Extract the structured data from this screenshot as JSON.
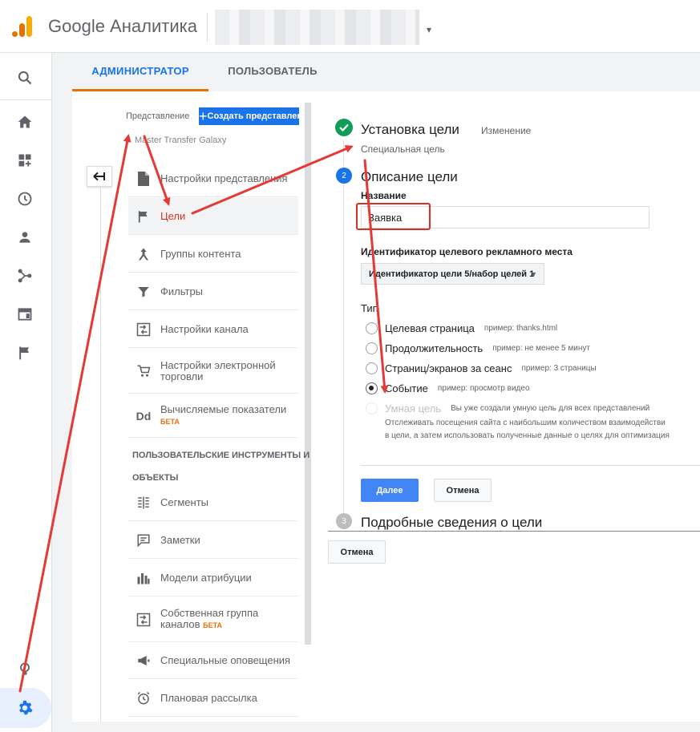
{
  "header": {
    "app_title": "Google Аналитика",
    "account_caret": "▾"
  },
  "tabs": [
    {
      "label": "АДМИНИСТРАТОР"
    },
    {
      "label": "ПОЛЬЗОВАТЕЛЬ"
    }
  ],
  "view": {
    "label": "Представление",
    "create_button": "Создать представление",
    "name": "Master Transfer Galaxy"
  },
  "menu": {
    "items": [
      {
        "label": "Настройки представления"
      },
      {
        "label": "Цели"
      },
      {
        "label": "Группы контента"
      },
      {
        "label": "Фильтры"
      },
      {
        "label": "Настройки канала"
      },
      {
        "label": "Настройки электронной торговли"
      },
      {
        "label": "Вычисляемые показатели",
        "badge": "БЕТА"
      }
    ],
    "section_tools": "ПОЛЬЗОВАТЕЛЬСКИЕ ИНСТРУМЕНТЫ И",
    "section_objects": "ОБЪЕКТЫ",
    "tools": [
      {
        "label": "Сегменты"
      },
      {
        "label": "Заметки"
      },
      {
        "label": "Модели атрибуции"
      },
      {
        "label": "Собственная группа каналов",
        "badge": "БЕТА"
      },
      {
        "label": "Специальные оповещения"
      },
      {
        "label": "Плановая рассылка"
      }
    ]
  },
  "goal": {
    "step1": {
      "title": "Установка цели",
      "edit": "Изменение",
      "subtitle": "Специальная цель"
    },
    "step2": {
      "number": "2",
      "title": "Описание цели"
    },
    "name_label": "Название",
    "name_value": "Заявка",
    "slot_label": "Идентификатор целевого рекламного места",
    "slot_value": "Идентификатор цели 5/набор целей 1",
    "type_label": "Тип",
    "types": [
      {
        "label": "Целевая страница",
        "example": "пример: thanks.html"
      },
      {
        "label": "Продолжительность",
        "example": "пример: не менее 5 минут"
      },
      {
        "label": "Страниц/экранов за сеанс",
        "example": "пример: 3 страницы"
      },
      {
        "label": "Событие",
        "example": "пример: просмотр видео"
      },
      {
        "label": "Умная цель",
        "example": "Вы уже создали умную цель для всех представлений"
      }
    ],
    "smart_desc_1": "Отслеживать посещения сайта с наибольшим количеством взаимодействи",
    "smart_desc_2": "в цели, а затем использовать полученные данные о целях для оптимизация",
    "next_button": "Далее",
    "cancel_button": "Отмена",
    "step3": {
      "number": "3",
      "title": "Подробные сведения о цели"
    },
    "outer_cancel": "Отмена"
  },
  "colors": {
    "accent": "#1a73e8",
    "tab_underline": "#e8710a",
    "arrow": "#e53935",
    "success": "#0f9d58"
  }
}
